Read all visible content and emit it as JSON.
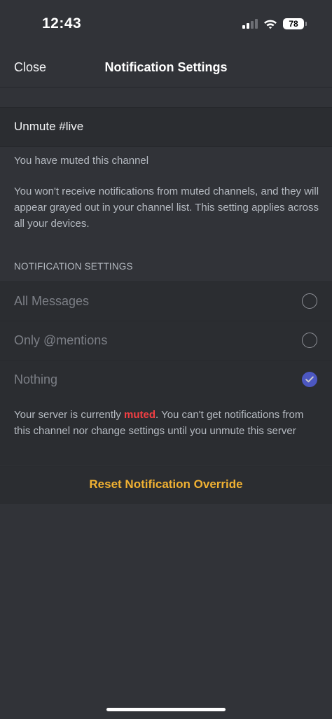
{
  "status_bar": {
    "time": "12:43",
    "battery": "78"
  },
  "nav": {
    "close_label": "Close",
    "title": "Notification Settings"
  },
  "unmute": {
    "label": "Unmute #live"
  },
  "muted_info": {
    "status": "You have muted this channel",
    "description": "You won't receive notifications from muted channels, and they will appear grayed out in your channel list. This setting applies across all your devices."
  },
  "notification_settings": {
    "header": "NOTIFICATION SETTINGS",
    "options": [
      {
        "label": "All Messages",
        "selected": false
      },
      {
        "label": "Only @mentions",
        "selected": false
      },
      {
        "label": "Nothing",
        "selected": true
      }
    ]
  },
  "server_note": {
    "prefix": "Your server is currently ",
    "muted_word": "muted",
    "suffix": ". You can't get notifications from this channel nor change settings until you unmute this server"
  },
  "reset": {
    "label": "Reset Notification Override"
  },
  "colors": {
    "background": "#313338",
    "panel": "#2b2d31",
    "accent_blue": "#5865f2",
    "muted_red": "#f23f43",
    "reset_gold": "#f0b132"
  },
  "icons": {
    "signal": "cellular-signal-icon",
    "wifi": "wifi-icon",
    "battery": "battery-icon",
    "checkmark": "checkmark-icon"
  }
}
